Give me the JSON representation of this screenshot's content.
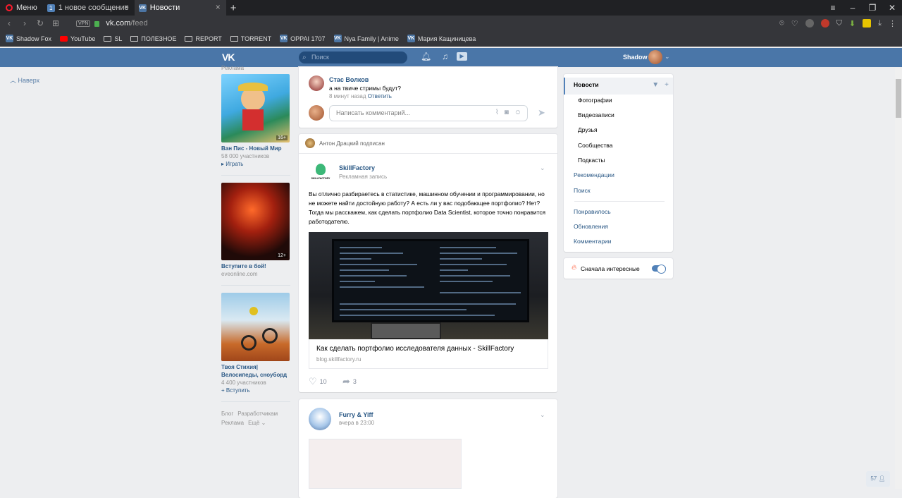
{
  "browser": {
    "menu_label": "Меню",
    "tabs": [
      {
        "label": "1 новое сообщение",
        "badge": "1"
      },
      {
        "label": "Новости",
        "favicon": "VK"
      }
    ],
    "url_host": "vk.com",
    "url_path": "/feed",
    "vpn_label": "VPN",
    "bookmarks": [
      {
        "label": "Shadow Fox",
        "icon": "vk-icon"
      },
      {
        "label": "YouTube",
        "icon": "youtube-icon"
      },
      {
        "label": "SL",
        "icon": "folder-icon"
      },
      {
        "label": "ПОЛЕЗНОЕ",
        "icon": "folder-icon"
      },
      {
        "label": "REPORT",
        "icon": "folder-icon"
      },
      {
        "label": "TORRENT",
        "icon": "folder-icon"
      },
      {
        "label": "OPPAI 1707",
        "icon": "vk-icon"
      },
      {
        "label": "Nya Family | Anime",
        "icon": "vk-icon"
      },
      {
        "label": "Мария Кащиницева",
        "icon": "vk-icon"
      }
    ]
  },
  "vk": {
    "logo": "VK",
    "search_placeholder": "Поиск",
    "user_name": "Shadow",
    "scroll_up": "Наверх",
    "online_count": "57"
  },
  "ads": {
    "label": "Реклама",
    "items": [
      {
        "title": "Ван Пис - Новый Мир",
        "sub": "58 000 участников",
        "action": "▸ Играть",
        "age": "16+"
      },
      {
        "title": "Вступите в бой!",
        "sub": "eveonline.com",
        "action": "",
        "age": "12+"
      },
      {
        "title": "Твоя Стихия| Велосипеды, сноуборд",
        "sub": "4 400 участников",
        "action": "+ Вступить",
        "age": ""
      }
    ],
    "footer": [
      "Блог",
      "Разработчикам",
      "Реклама",
      "Ещё ⌄"
    ]
  },
  "comment": {
    "author": "Стас Волков",
    "text": "а на твиче стримы будут?",
    "time": "8 минут назад",
    "reply": "Ответить",
    "input_placeholder": "Написать комментарий..."
  },
  "post": {
    "subscribed_note": "Антон Драцкий подписан",
    "author": "SkillFactory",
    "type": "Рекламная запись",
    "logo_text": "SKILLFACTORY",
    "text": "Вы отлично разбираетесь в статистике, машинном обучении и программировании, но не можете найти достойную работу? А есть ли у вас подобающее портфолио? Нет? Тогда мы расскажем, как сделать портфолио Data Scientist, которое точно понравится работодателю.",
    "link_title": "Как сделать портфолио исследователя данных - SkillFactory",
    "link_url": "blog.skillfactory.ru",
    "likes": "10",
    "shares": "3"
  },
  "post2": {
    "author": "Furry & Yiff",
    "time": "вчера в 23:00"
  },
  "right_menu": {
    "active": "Новости",
    "subitems": [
      "Фотографии",
      "Видеозаписи",
      "Друзья",
      "Сообщества",
      "Подкасты"
    ],
    "items_a": [
      "Рекомендации",
      "Поиск"
    ],
    "items_b": [
      "Понравилось",
      "Обновления",
      "Комментарии"
    ],
    "toggle_label": "Сначала интересные"
  }
}
